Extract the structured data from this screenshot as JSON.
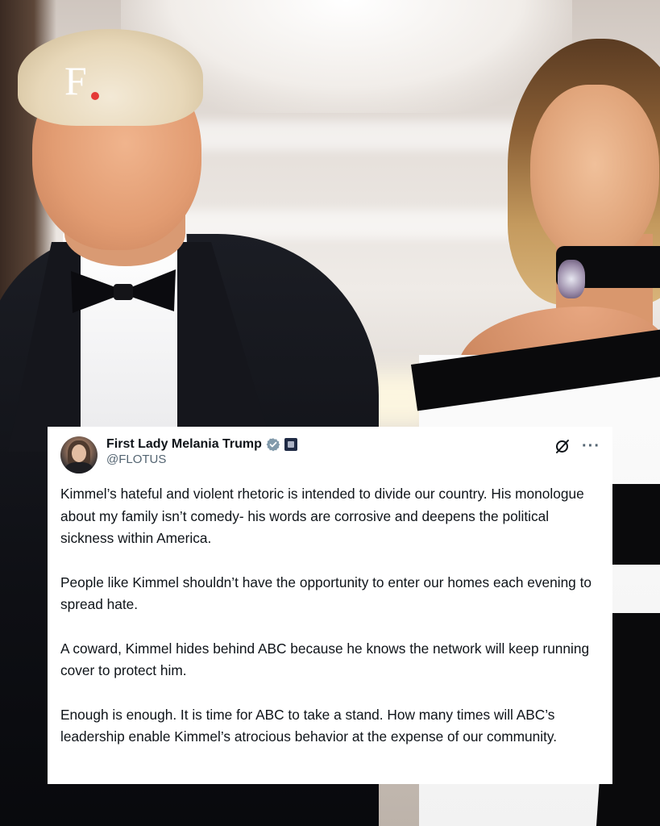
{
  "logo": {
    "letter": "F",
    "dot_color": "#e53935"
  },
  "tweet": {
    "display_name": "First Lady Melania Trump",
    "handle": "@FLOTUS",
    "verified_color": "#829aab",
    "paragraphs": [
      "Kimmel’s hateful and violent rhetoric is intended to divide our country. His monologue about my family isn’t comedy- his words are corrosive and deepens the political sickness within America.",
      "People like Kimmel shouldn’t have the opportunity to enter our homes each evening to spread hate.",
      "A coward, Kimmel hides behind ABC because he knows the network will keep running cover to protect him.",
      "Enough is enough.  It is time for ABC to take a stand.  How many times will ABC’s leadership enable Kimmel’s atrocious behavior at the expense of our community."
    ],
    "more_label": "···"
  }
}
